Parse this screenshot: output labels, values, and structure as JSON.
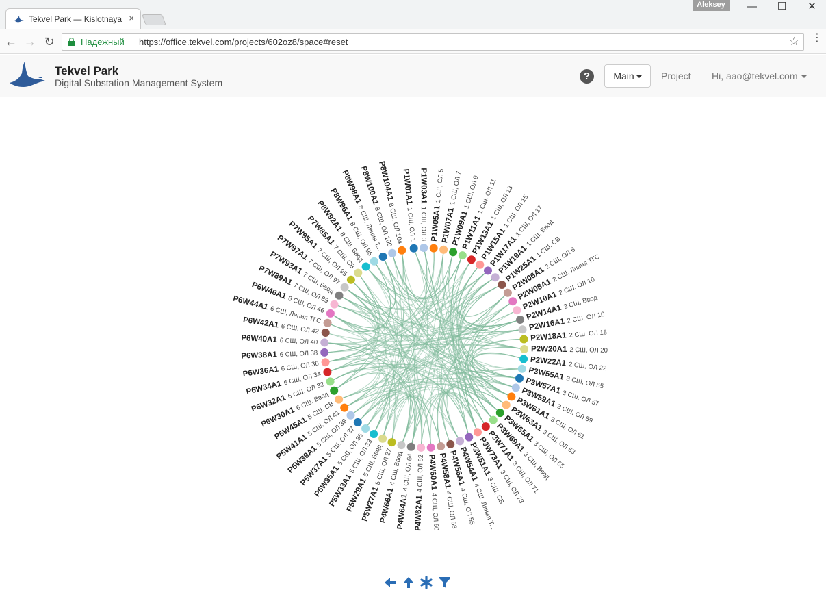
{
  "browser": {
    "tab_title": "Tekvel Park — Kislotnaya",
    "tab_close": "×",
    "user_badge": "Aleksey",
    "secure_label": "Надежный",
    "url": "https://office.tekvel.com/projects/602oz8/space#reset"
  },
  "app": {
    "brand_title": "Tekvel Park",
    "brand_subtitle": "Digital Substation Management System",
    "help": "?",
    "main_menu": "Main",
    "project_link": "Project",
    "user_menu": "Hi, aao@tekvel.com"
  },
  "icons": {
    "back": "arrow-left-icon",
    "up": "arrow-up-icon",
    "reset": "asterisk-icon",
    "filter": "filter-icon",
    "accent": "#2a6db5",
    "link_color": "#7fb99a"
  },
  "chart_data": {
    "type": "hierarchical-edge-bundling",
    "nodes": [
      {
        "id": "P1W01A1",
        "label": "1 СШ, ОЛ 1",
        "color": "#1f77b4"
      },
      {
        "id": "P1W03A1",
        "label": "1 СШ, ОЛ 3",
        "color": "#aec7e8"
      },
      {
        "id": "P1W05A1",
        "label": "1 СШ, ОЛ 5",
        "color": "#ff7f0e"
      },
      {
        "id": "P1W07A1",
        "label": "1 СШ, ОЛ 7",
        "color": "#ffbb78"
      },
      {
        "id": "P1W09A1",
        "label": "1 СШ, ОЛ 9",
        "color": "#2ca02c"
      },
      {
        "id": "P1W11A1",
        "label": "1 СШ, ОЛ 11",
        "color": "#98df8a"
      },
      {
        "id": "P1W13A1",
        "label": "1 СШ, ОЛ 13",
        "color": "#d62728"
      },
      {
        "id": "P1W15A1",
        "label": "1 СШ, ОЛ 15",
        "color": "#ff9896"
      },
      {
        "id": "P1W17A1",
        "label": "1 СШ, ОЛ 17",
        "color": "#9467bd"
      },
      {
        "id": "P1W19A1",
        "label": "1 СШ, Ввод",
        "color": "#c5b0d5"
      },
      {
        "id": "P1W25A1",
        "label": "1 СШ, СВ",
        "color": "#8c564b"
      },
      {
        "id": "P2W06A1",
        "label": "2 СШ, ОЛ 6",
        "color": "#c49c94"
      },
      {
        "id": "P2W08A1",
        "label": "2 СШ, Линия ТГС",
        "color": "#e377c2"
      },
      {
        "id": "P2W10A1",
        "label": "2 СШ, ОЛ 10",
        "color": "#f7b6d2"
      },
      {
        "id": "P2W14A1",
        "label": "2 СШ, Ввод",
        "color": "#7f7f7f"
      },
      {
        "id": "P2W16A1",
        "label": "2 СШ, ОЛ 16",
        "color": "#c7c7c7"
      },
      {
        "id": "P2W18A1",
        "label": "2 СШ, ОЛ 18",
        "color": "#bcbd22"
      },
      {
        "id": "P2W20A1",
        "label": "2 СШ, ОЛ 20",
        "color": "#dbdb8d"
      },
      {
        "id": "P2W22A1",
        "label": "2 СШ, ОЛ 22",
        "color": "#17becf"
      },
      {
        "id": "P3W55A1",
        "label": "3 СШ, ОЛ 55",
        "color": "#9edae5"
      },
      {
        "id": "P3W57A1",
        "label": "3 СШ, ОЛ 57",
        "color": "#1f77b4"
      },
      {
        "id": "P3W59A1",
        "label": "3 СШ, ОЛ 59",
        "color": "#aec7e8"
      },
      {
        "id": "P3W61A1",
        "label": "3 СШ, ОЛ 61",
        "color": "#ff7f0e"
      },
      {
        "id": "P3W63A1",
        "label": "3 СШ, ОЛ 63",
        "color": "#ffbb78"
      },
      {
        "id": "P3W65A1",
        "label": "3 СШ, ОЛ 65",
        "color": "#2ca02c"
      },
      {
        "id": "P3W69A1",
        "label": "3 СШ, Ввод",
        "color": "#98df8a"
      },
      {
        "id": "P3W71A1",
        "label": "3 СШ, ОЛ 71",
        "color": "#d62728"
      },
      {
        "id": "P3W73A1",
        "label": "3 СШ, ОЛ 73",
        "color": "#ff9896"
      },
      {
        "id": "P3W51A1",
        "label": "3 СШ, СВ",
        "color": "#9467bd"
      },
      {
        "id": "P4W54A1",
        "label": "4 СШ, Линия Т...",
        "color": "#c5b0d5"
      },
      {
        "id": "P4W56A1",
        "label": "4 СШ, ОЛ 56",
        "color": "#8c564b"
      },
      {
        "id": "P4W58A1",
        "label": "4 СШ, ОЛ 58",
        "color": "#c49c94"
      },
      {
        "id": "P4W60A1",
        "label": "4 СШ, ОЛ 60",
        "color": "#e377c2"
      },
      {
        "id": "P4W62A1",
        "label": "4 СШ, ОЛ 62",
        "color": "#f7b6d2"
      },
      {
        "id": "P4W64A1",
        "label": "4 СШ, ОЛ 64",
        "color": "#7f7f7f"
      },
      {
        "id": "P4W66A1",
        "label": "4 СШ, Ввод",
        "color": "#c7c7c7"
      },
      {
        "id": "P5W27A1",
        "label": "5 СШ, ОЛ 27",
        "color": "#bcbd22"
      },
      {
        "id": "P5W29A1",
        "label": "5 СШ, Ввод",
        "color": "#dbdb8d"
      },
      {
        "id": "P5W33A1",
        "label": "5 СШ, ОЛ 33",
        "color": "#17becf"
      },
      {
        "id": "P5W35A1",
        "label": "5 СШ, ОЛ 35",
        "color": "#9edae5"
      },
      {
        "id": "P5W37A1",
        "label": "5 СШ, ОЛ 37",
        "color": "#1f77b4"
      },
      {
        "id": "P5W39A1",
        "label": "5 СШ, ОЛ 39",
        "color": "#aec7e8"
      },
      {
        "id": "P5W41A1",
        "label": "5 СШ, ОЛ 41",
        "color": "#ff7f0e"
      },
      {
        "id": "P5W45A1",
        "label": "5 СШ, СВ",
        "color": "#ffbb78"
      },
      {
        "id": "P6W30A1",
        "label": "6 СШ, Ввод",
        "color": "#2ca02c"
      },
      {
        "id": "P6W32A1",
        "label": "6 СШ, ОЛ 32",
        "color": "#98df8a"
      },
      {
        "id": "P6W34A1",
        "label": "6 СШ, ОЛ 34",
        "color": "#d62728"
      },
      {
        "id": "P6W36A1",
        "label": "6 СШ, ОЛ 36",
        "color": "#ff9896"
      },
      {
        "id": "P6W38A1",
        "label": "6 СШ, ОЛ 38",
        "color": "#9467bd"
      },
      {
        "id": "P6W40A1",
        "label": "6 СШ, ОЛ 40",
        "color": "#c5b0d5"
      },
      {
        "id": "P6W42A1",
        "label": "6 СШ, ОЛ 42",
        "color": "#8c564b"
      },
      {
        "id": "P6W44A1",
        "label": "6 СШ, Линия ТГС",
        "color": "#c49c94"
      },
      {
        "id": "P6W46A1",
        "label": "6 СШ, ОЛ 46",
        "color": "#e377c2"
      },
      {
        "id": "P7W89A1",
        "label": "7 СШ, ОЛ 89",
        "color": "#f7b6d2"
      },
      {
        "id": "P7W93A1",
        "label": "7 СШ, Ввод",
        "color": "#7f7f7f"
      },
      {
        "id": "P7W97A1",
        "label": "7 СШ, ОЛ 97",
        "color": "#c7c7c7"
      },
      {
        "id": "P7W95A1",
        "label": "7 СШ, ОЛ 95",
        "color": "#bcbd22"
      },
      {
        "id": "P7W85A1",
        "label": "7 СШ, СВ",
        "color": "#dbdb8d"
      },
      {
        "id": "P8W92A1",
        "label": "8 СШ, Ввод",
        "color": "#17becf"
      },
      {
        "id": "P8W96A1",
        "label": "8 СШ, ОЛ 96",
        "color": "#9edae5"
      },
      {
        "id": "P8W98A1",
        "label": "8 СШ, Линия Т...",
        "color": "#1f77b4"
      },
      {
        "id": "P8W100A1",
        "label": "8 СШ, ОЛ 100",
        "color": "#aec7e8"
      },
      {
        "id": "P8W104A1",
        "label": "8 СШ, ОЛ 104",
        "color": "#ff7f0e"
      }
    ]
  }
}
